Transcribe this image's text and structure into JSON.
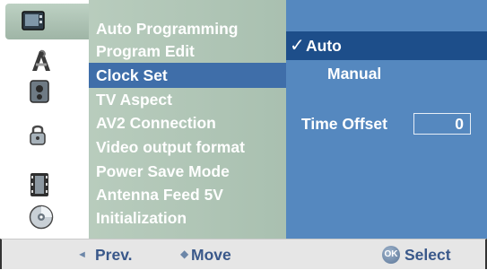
{
  "colors": {
    "menu_bg": "#a9c0b0",
    "selected_menu": "#3f6ea9",
    "options_bg": "#5588bf",
    "selected_option": "#1d4e8a",
    "bottom_text": "#39588a"
  },
  "icons": [
    {
      "name": "tv-setup-icon",
      "active": true
    },
    {
      "name": "language-icon",
      "active": false
    },
    {
      "name": "audio-icon",
      "active": false
    },
    {
      "name": "lock-icon",
      "active": false
    },
    {
      "name": "film-recording-icon",
      "active": false
    },
    {
      "name": "disc-icon",
      "active": false
    }
  ],
  "menu": {
    "items": [
      "Auto Programming",
      "Program Edit",
      "Clock Set",
      "TV Aspect",
      "AV2 Connection",
      "Video output format",
      "Power Save Mode",
      "Antenna Feed 5V",
      "Initialization"
    ],
    "selected_index": 2
  },
  "options": {
    "check_mark": "✓",
    "auto": "Auto",
    "manual": "Manual",
    "time_offset_label": "Time Offset",
    "time_offset_value": "0"
  },
  "bottom_bar": {
    "prev_arrow": "◄",
    "prev": "Prev.",
    "move_arrow": "◆",
    "move": "Move",
    "ok_badge": "OK",
    "select": "Select"
  }
}
